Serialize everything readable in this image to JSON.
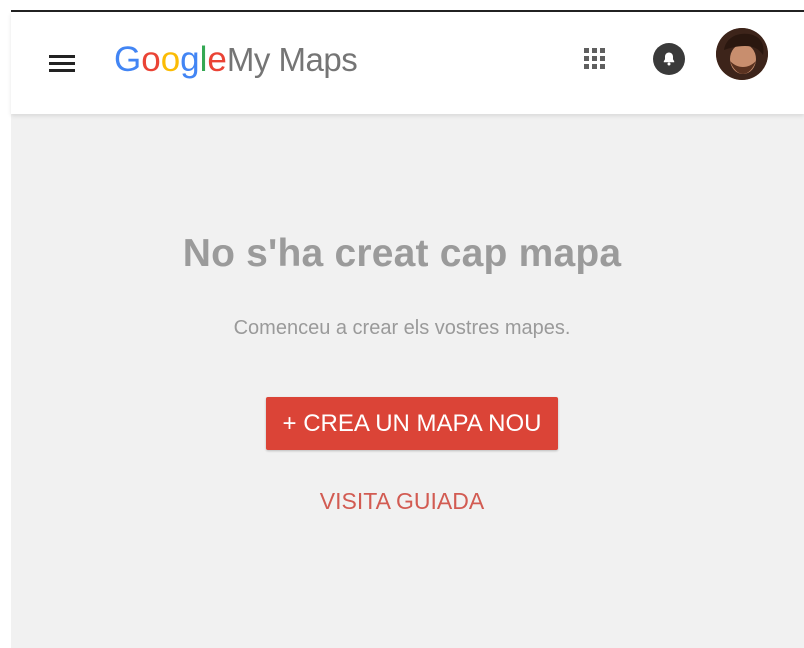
{
  "header": {
    "logo": {
      "brand_letters": [
        "G",
        "o",
        "o",
        "g",
        "l",
        "e"
      ],
      "brand_colors": [
        "#4285F4",
        "#EA4335",
        "#FBBC05",
        "#4285F4",
        "#34A853",
        "#EA4335"
      ],
      "product": "My Maps"
    },
    "icons": {
      "menu": "menu-icon",
      "apps": "apps-grid-icon",
      "notifications": "notifications-bell-icon",
      "account": "user-avatar"
    }
  },
  "main": {
    "empty_state": {
      "title": "No s'ha creat cap mapa",
      "subtitle": "Comenceu a crear els vostres mapes.",
      "create_button": "+ CREA UN MAPA NOU",
      "tour_link": "VISITA GUIADA"
    }
  },
  "colors": {
    "accent": "#DB4437",
    "link": "#D25B52",
    "background": "#F1F1F1",
    "muted_text": "#9B9B9B"
  }
}
